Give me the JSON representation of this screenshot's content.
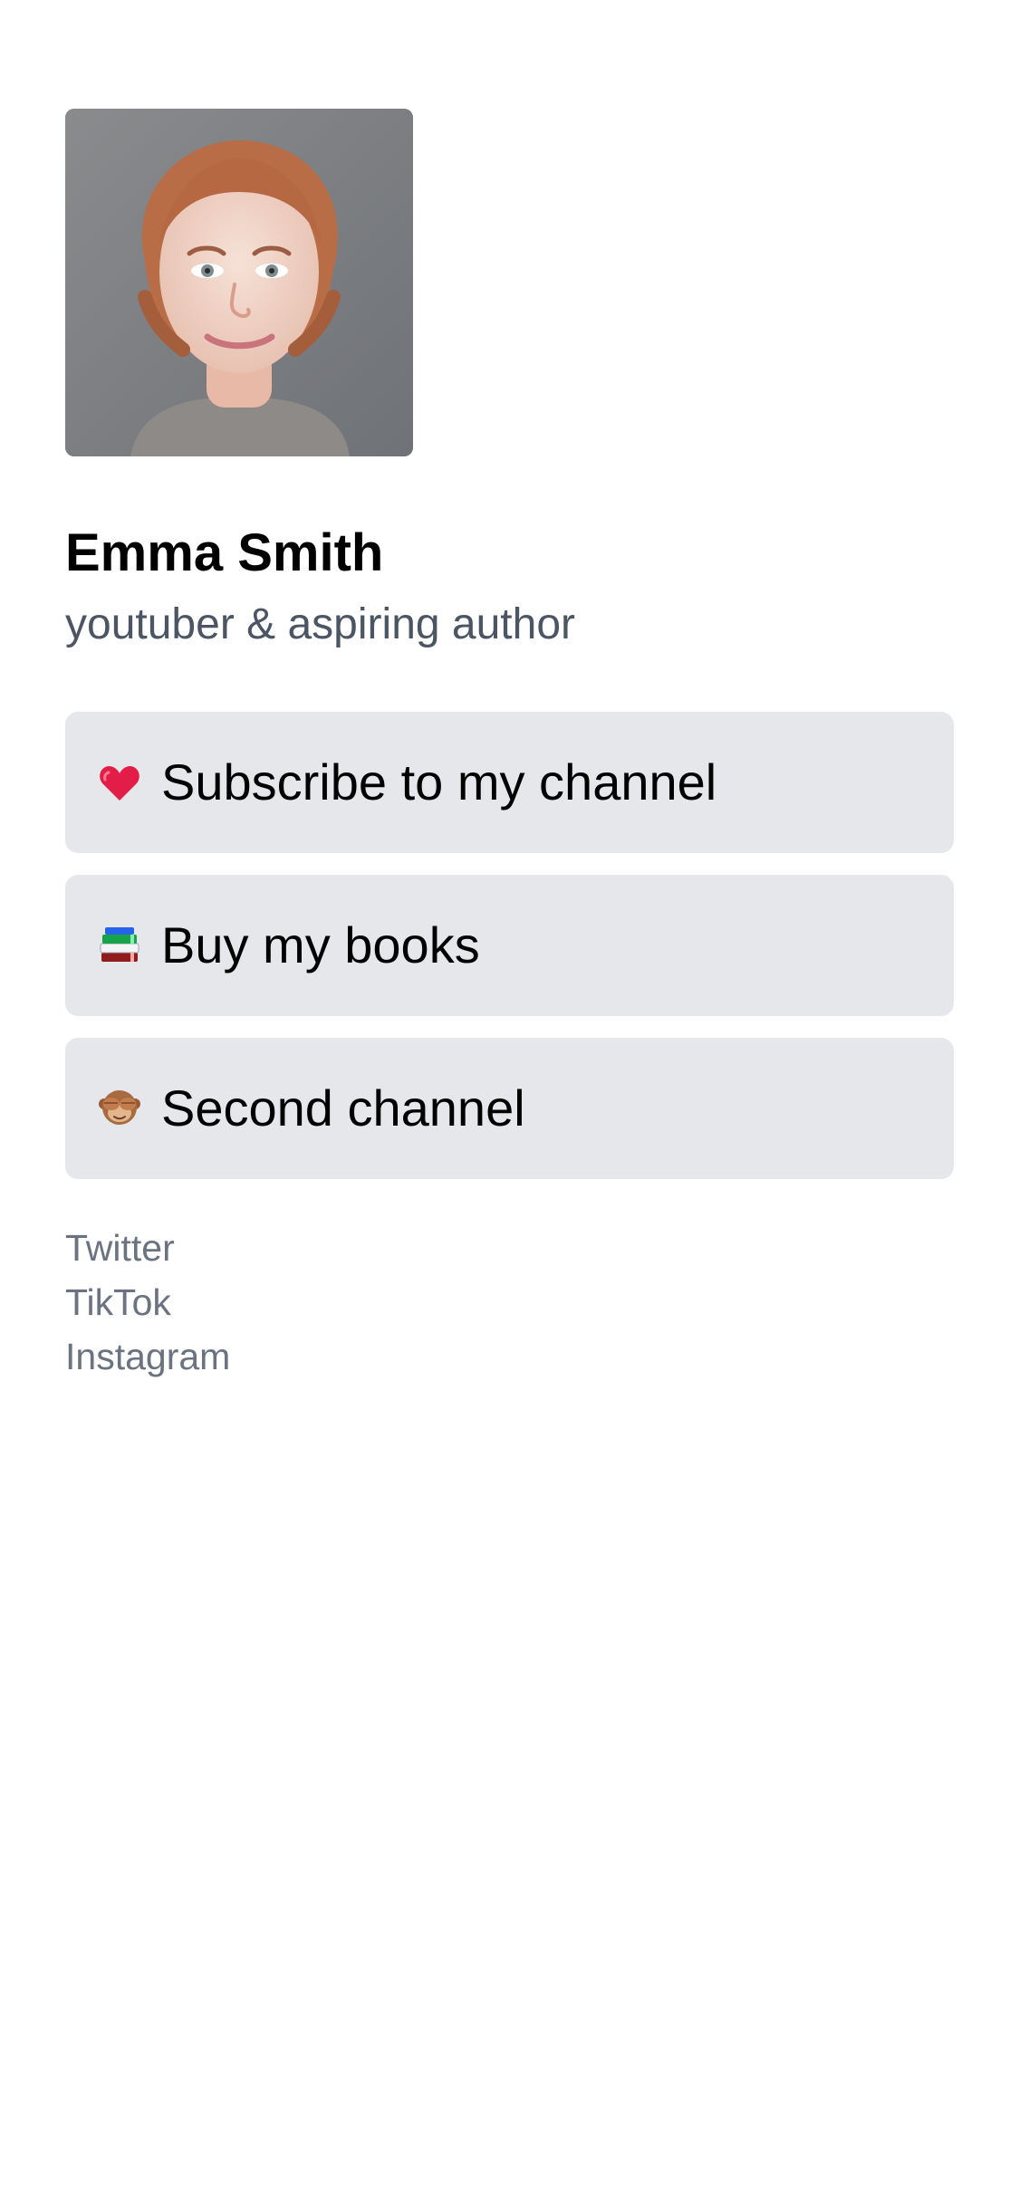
{
  "profile": {
    "name": "Emma Smith",
    "tagline": "youtuber & aspiring author"
  },
  "links": [
    {
      "icon": "red-heart-icon",
      "label": "Subscribe to my channel"
    },
    {
      "icon": "books-icon",
      "label": "Buy my books"
    },
    {
      "icon": "see-no-evil-monkey-icon",
      "label": "Second channel"
    }
  ],
  "socials": [
    {
      "label": "Twitter"
    },
    {
      "label": "TikTok"
    },
    {
      "label": "Instagram"
    }
  ],
  "colors": {
    "background": "#ffffff",
    "button_background": "#e5e7eb",
    "tagline_text": "#4b5563",
    "social_text": "#6b7280",
    "heart": "#e11d48"
  }
}
